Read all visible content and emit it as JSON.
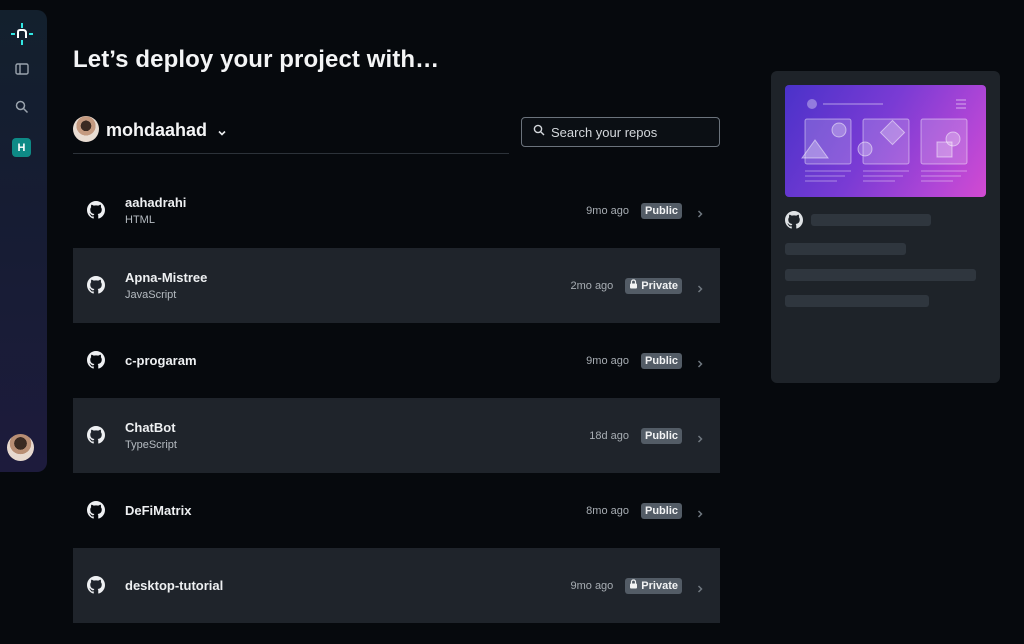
{
  "sidebar": {
    "logo_icon": "netlify-logo-icon",
    "panel_icon": "sidebar-toggle-icon",
    "search_icon": "search-icon",
    "team_initial": "H",
    "team_color": "#0e8a86"
  },
  "heading": "Let’s deploy your project with…",
  "account": {
    "name": "mohdaahad"
  },
  "search": {
    "placeholder": "Search your repos"
  },
  "repos": [
    {
      "name": "aahadrahi",
      "language": "HTML",
      "time": "9mo ago",
      "visibility": "Public",
      "private": false
    },
    {
      "name": "Apna-Mistree",
      "language": "JavaScript",
      "time": "2mo ago",
      "visibility": "Private",
      "private": true
    },
    {
      "name": "c-progaram",
      "language": "",
      "time": "9mo ago",
      "visibility": "Public",
      "private": false
    },
    {
      "name": "ChatBot",
      "language": "TypeScript",
      "time": "18d ago",
      "visibility": "Public",
      "private": false
    },
    {
      "name": "DeFiMatrix",
      "language": "",
      "time": "8mo ago",
      "visibility": "Public",
      "private": false
    },
    {
      "name": "desktop-tutorial",
      "language": "",
      "time": "9mo ago",
      "visibility": "Private",
      "private": true
    }
  ],
  "colors": {
    "background": "#06090d",
    "row_alt": "#1f242b",
    "badge": "#535c66",
    "accent_teal": "#32e6e2"
  }
}
